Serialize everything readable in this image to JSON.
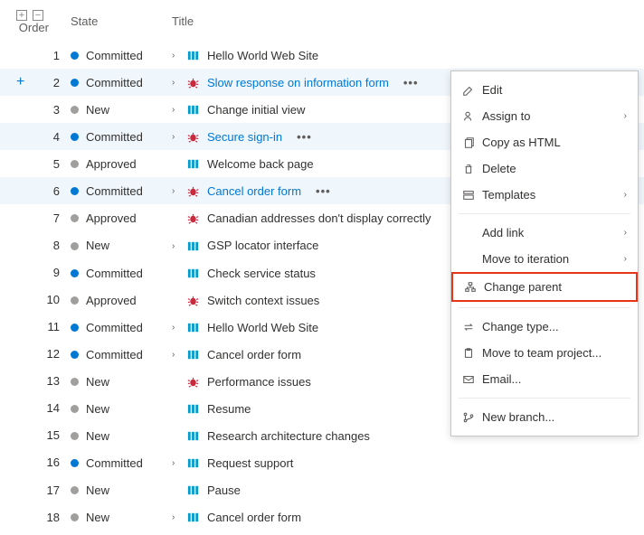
{
  "headers": {
    "order": "Order",
    "state": "State",
    "title": "Title"
  },
  "states": {
    "committed": "Committed",
    "new": "New",
    "approved": "Approved"
  },
  "rows": [
    {
      "order": 1,
      "state": "committed",
      "dot": "blue",
      "chev": true,
      "type": "story",
      "title": "Hello World Web Site",
      "link": false
    },
    {
      "order": 2,
      "state": "committed",
      "dot": "blue",
      "chev": true,
      "type": "bug",
      "title": "Slow response on information form",
      "link": true,
      "selected": true,
      "more": true,
      "add": true
    },
    {
      "order": 3,
      "state": "new",
      "dot": "gray",
      "chev": true,
      "type": "story",
      "title": "Change initial view",
      "link": false
    },
    {
      "order": 4,
      "state": "committed",
      "dot": "blue",
      "chev": true,
      "type": "bug",
      "title": "Secure sign-in",
      "link": true,
      "selected": true,
      "more": true
    },
    {
      "order": 5,
      "state": "approved",
      "dot": "gray",
      "chev": false,
      "type": "story",
      "title": "Welcome back page",
      "link": false
    },
    {
      "order": 6,
      "state": "committed",
      "dot": "blue",
      "chev": true,
      "type": "bug",
      "title": "Cancel order form",
      "link": true,
      "selected": true,
      "more": true
    },
    {
      "order": 7,
      "state": "approved",
      "dot": "gray",
      "chev": false,
      "type": "bug",
      "title": "Canadian addresses don't display correctly",
      "link": false
    },
    {
      "order": 8,
      "state": "new",
      "dot": "gray",
      "chev": true,
      "type": "story",
      "title": "GSP locator interface",
      "link": false
    },
    {
      "order": 9,
      "state": "committed",
      "dot": "blue",
      "chev": false,
      "type": "story",
      "title": "Check service status",
      "link": false
    },
    {
      "order": 10,
      "state": "approved",
      "dot": "gray",
      "chev": false,
      "type": "bug",
      "title": "Switch context issues",
      "link": false
    },
    {
      "order": 11,
      "state": "committed",
      "dot": "blue",
      "chev": true,
      "type": "story",
      "title": "Hello World Web Site",
      "link": false
    },
    {
      "order": 12,
      "state": "committed",
      "dot": "blue",
      "chev": true,
      "type": "story",
      "title": "Cancel order form",
      "link": false
    },
    {
      "order": 13,
      "state": "new",
      "dot": "gray",
      "chev": false,
      "type": "bug",
      "title": "Performance issues",
      "link": false
    },
    {
      "order": 14,
      "state": "new",
      "dot": "gray",
      "chev": false,
      "type": "story",
      "title": "Resume",
      "link": false
    },
    {
      "order": 15,
      "state": "new",
      "dot": "gray",
      "chev": false,
      "type": "story",
      "title": "Research architecture changes",
      "link": false
    },
    {
      "order": 16,
      "state": "committed",
      "dot": "blue",
      "chev": true,
      "type": "story",
      "title": "Request support",
      "link": false
    },
    {
      "order": 17,
      "state": "new",
      "dot": "gray",
      "chev": false,
      "type": "story",
      "title": "Pause",
      "link": false
    },
    {
      "order": 18,
      "state": "new",
      "dot": "gray",
      "chev": true,
      "type": "story",
      "title": "Cancel order form",
      "link": false
    }
  ],
  "menu": {
    "edit": "Edit",
    "assign_to": "Assign to",
    "copy_html": "Copy as HTML",
    "delete": "Delete",
    "templates": "Templates",
    "add_link": "Add link",
    "move_iteration": "Move to iteration",
    "change_parent": "Change parent",
    "change_type": "Change type...",
    "move_project": "Move to team project...",
    "email": "Email...",
    "new_branch": "New branch..."
  },
  "glyphs": {
    "more": "•••",
    "chev_right": "›",
    "plus": "+",
    "minus": "−"
  }
}
